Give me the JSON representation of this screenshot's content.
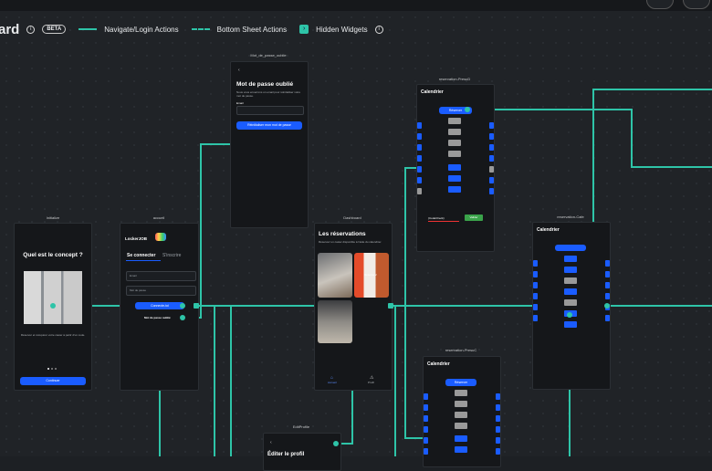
{
  "legend": {
    "title": "ard",
    "beta": "BETA",
    "navigate": "Navigate/Login Actions",
    "bottom_sheet": "Bottom Sheet Actions",
    "hidden": "Hidden Widgets"
  },
  "screens": {
    "initialize": {
      "label": "Initialize",
      "headline": "Quel est le concept ?",
      "caption": "Réserver et récupérer votre casier à partir d'un code.",
      "button": "Continuer"
    },
    "accueil": {
      "label": "accueil",
      "logo": "LockerJOB",
      "tab_login": "Se connecter",
      "tab_signup": "S'inscrire",
      "email_ph": "Email",
      "password_ph": "Mot de passe",
      "login_btn": "Connecte-toi",
      "forgot_link": "Mot de passe oublié"
    },
    "mot_de_passe": {
      "label": "Mot_de_passe_oublie",
      "title": "Mot de passe oublié",
      "desc": "Nous vous enverrons un email pour réinitialiser votre mot de passe.",
      "email_label": "Email",
      "button": "Réinitialiser mon mot de passe"
    },
    "dashboard": {
      "label": "Dashboard",
      "title": "Les réservations",
      "subtitle": "Réservez un casier disponible à l'aide du calendrier.",
      "img2": "Réserve 2",
      "nav_home": "Accueil",
      "nav_profile": "Profil"
    },
    "resa_presud": {
      "label": "reservation-PresuD",
      "title": "Calendrier",
      "top_btn": "Réserver",
      "code_label": "(CodeCheck)",
      "valider": "Valider"
    },
    "resa_cafe": {
      "label": "reservation-Cafe",
      "title": "Calendrier"
    },
    "resa_presuc": {
      "label": "reservation-PresuC",
      "title": "Calendrier",
      "top_btn": "Réserver"
    },
    "edit_profile": {
      "label": "EditProfile",
      "title": "Éditer le profil"
    }
  },
  "colors": {
    "accent": "#2ec4a8",
    "primary": "#1a5cff",
    "background": "#202327"
  }
}
